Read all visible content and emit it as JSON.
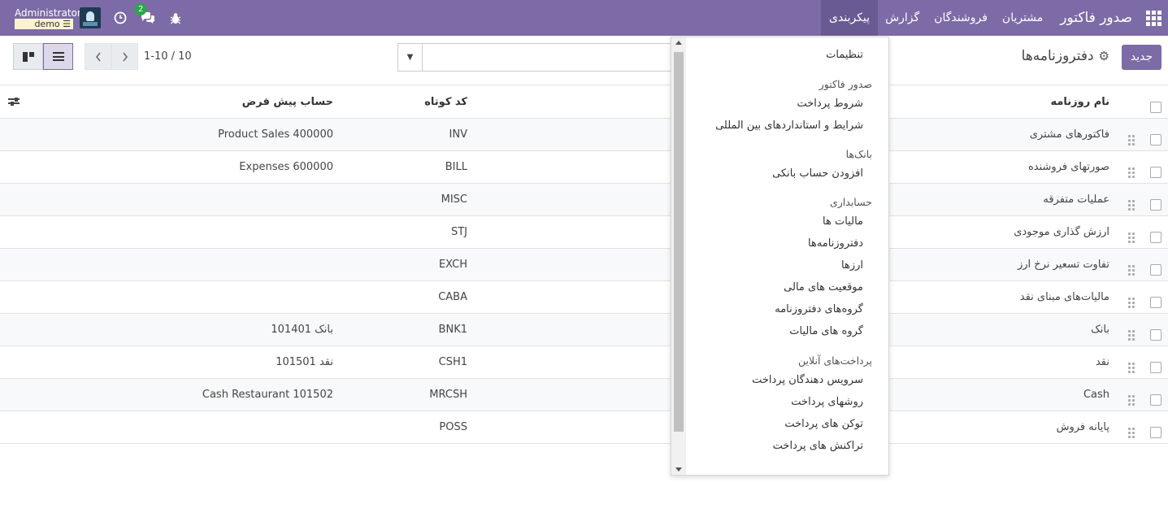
{
  "navbar": {
    "brand": "صدور فاکتور",
    "menu": [
      "مشتریان",
      "فروشندگان",
      "گزارش",
      "پیکربندی"
    ],
    "active_menu": "پیکربندی",
    "user_name": "Administrator",
    "database": "demo",
    "chat_badge": "2",
    "icons": [
      "apps-icon",
      "clock-icon",
      "chat-icon",
      "bug-icon"
    ]
  },
  "control": {
    "new_button": "جدید",
    "breadcrumb": "دفتروزنامه‌ها",
    "search_placeholder": "",
    "pager_value": "1-10 / 10"
  },
  "table": {
    "headers": {
      "name": "نام روزنامه",
      "code": "کد کوتاه",
      "default_account": "حساب پیش فرض"
    },
    "rows": [
      {
        "name": "فاکتورهای مشتری",
        "code": "INV",
        "account": "Product Sales 400000"
      },
      {
        "name": "صورتهای فروشنده",
        "code": "BILL",
        "account": "Expenses 600000"
      },
      {
        "name": "عملیات متفرقه",
        "code": "MISC",
        "account": ""
      },
      {
        "name": "ارزش گذاری موجودی",
        "code": "STJ",
        "account": ""
      },
      {
        "name": "تفاوت تسعیر نرخ ارز",
        "code": "EXCH",
        "account": ""
      },
      {
        "name": "مالیات‌های مبنای نقد",
        "code": "CABA",
        "account": ""
      },
      {
        "name": "بانک",
        "code": "BNK1",
        "account": "101401 بانک"
      },
      {
        "name": "نقد",
        "code": "CSH1",
        "account": "101501 نقد"
      },
      {
        "name": "Cash",
        "code": "MRCSH",
        "account": "Cash Restaurant 101502"
      },
      {
        "name": "پایانه فروش",
        "code": "POSS",
        "account": ""
      }
    ]
  },
  "dropdown": {
    "settings": "تنظیمات",
    "sections": [
      {
        "header": "صدور فاکتور",
        "items": [
          "شروط پرداخت",
          "شرایط و استانداردهای بین المللی"
        ]
      },
      {
        "header": "بانک‌ها",
        "items": [
          "افزودن حساب بانکی"
        ]
      },
      {
        "header": "حسابداری",
        "items": [
          "مالیات ها",
          "دفتروزنامه‌ها",
          "ارزها",
          "موقعیت های مالی",
          "گروه‌های دفتروزنامه",
          "گروه های مالیات"
        ]
      },
      {
        "header": "پرداخت‌های آنلاین",
        "items": [
          "سرویس دهندگان پرداخت",
          "روشهای پرداخت",
          "توکن های پرداخت",
          "تراکنش های پرداخت"
        ]
      }
    ]
  }
}
